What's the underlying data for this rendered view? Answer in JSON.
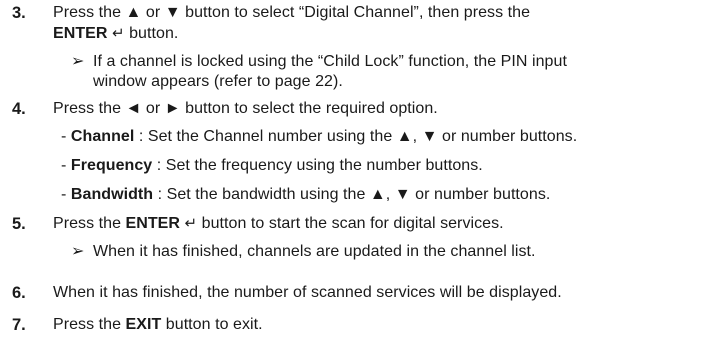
{
  "steps": [
    {
      "number": "3.",
      "line1": "Press the ▲ or ▼ button to select “Digital Channel”, then press the",
      "enter_label": "ENTER",
      "enter_icon": "↵",
      "line2_tail": " button.",
      "note_marker": "➢",
      "note_line1": "If a channel is locked using the “Child Lock” function, the PIN input",
      "note_line2": "window appears (refer to page 22)."
    },
    {
      "number": "4.",
      "text": "Press the ◄ or ► button to select the required option.",
      "options": [
        {
          "dash": "-",
          "label": "Channel",
          "desc": " : Set the Channel number using the ▲, ▼ or number buttons."
        },
        {
          "dash": "-",
          "label": "Frequency",
          "desc": " : Set the frequency using the number buttons."
        },
        {
          "dash": "-",
          "label": "Bandwidth",
          "desc": " : Set the bandwidth using the ▲, ▼ or number buttons."
        }
      ]
    },
    {
      "number": "5.",
      "text_pre": "Press the ",
      "enter_label": "ENTER",
      "enter_icon": "↵",
      "text_post": " button to start the scan for digital services.",
      "note_marker": "➢",
      "note": "When it has finished, channels are updated in the channel list."
    },
    {
      "number": "6.",
      "text": "When it has finished, the number of scanned services will be displayed."
    },
    {
      "number": "7.",
      "text_pre": "Press the ",
      "bold": "EXIT",
      "text_post": " button to exit."
    }
  ]
}
